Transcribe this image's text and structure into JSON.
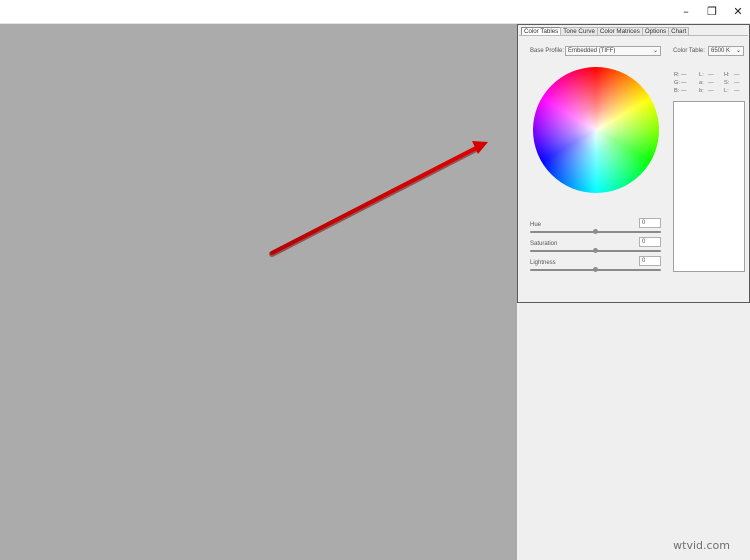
{
  "window": {
    "minimize_icon": "–",
    "maximize_icon": "❐",
    "close_icon": "✕"
  },
  "tabs": [
    "Color Tables",
    "Tone Curve",
    "Color Matrices",
    "Options",
    "Chart"
  ],
  "base_profile": {
    "label": "Base Profile:",
    "value": "Embedded (TIFF)"
  },
  "color_table": {
    "label": "Color Table:",
    "value": "6500 K"
  },
  "readouts": [
    {
      "label": "R:",
      "value": "—"
    },
    {
      "label": "G:",
      "value": "—"
    },
    {
      "label": "B:",
      "value": "—"
    },
    {
      "label": "L:",
      "value": "—"
    },
    {
      "label": "a:",
      "value": "—"
    },
    {
      "label": "b:",
      "value": "—"
    },
    {
      "label": "H:",
      "value": "—"
    },
    {
      "label": "S:",
      "value": "—"
    },
    {
      "label": "L:",
      "value": "—"
    }
  ],
  "sliders": [
    {
      "label": "Hue",
      "value": "0",
      "position": 0.5
    },
    {
      "label": "Saturation",
      "value": "0",
      "position": 0.5
    },
    {
      "label": "Lightness",
      "value": "0",
      "position": 0.5
    }
  ],
  "colors": {
    "canvas": "#ababab",
    "arrow": "#d00000"
  },
  "watermark": "wtvid.com"
}
